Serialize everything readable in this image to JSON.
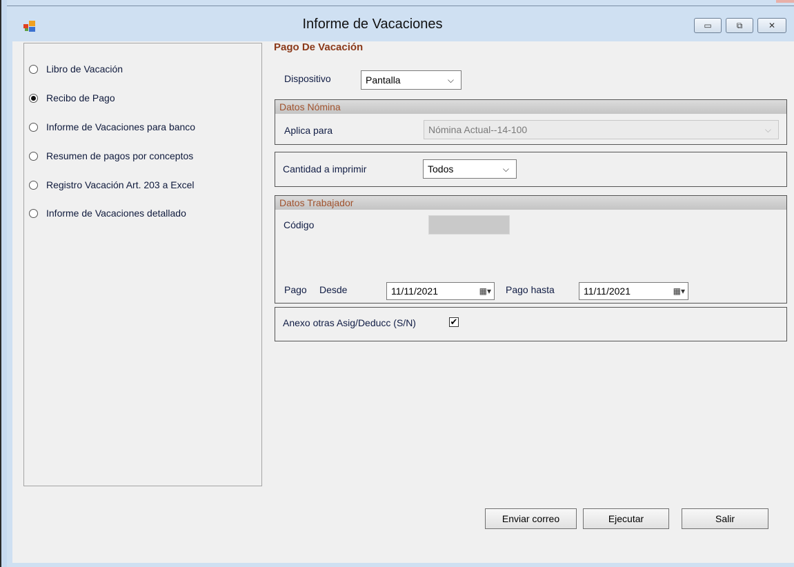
{
  "window": {
    "title": "Informe de Vacaciones",
    "minimize_label": "▭",
    "maximize_label": "⧉",
    "close_label": "✕"
  },
  "report_options": [
    {
      "label": "Libro de Vacación",
      "checked": false
    },
    {
      "label": "Recibo de Pago",
      "checked": true
    },
    {
      "label": "Informe de Vacaciones para banco",
      "checked": false
    },
    {
      "label": "Resumen de pagos por conceptos",
      "checked": false
    },
    {
      "label": "Registro Vacación Art. 203 a Excel",
      "checked": false
    },
    {
      "label": "Informe de Vacaciones detallado",
      "checked": false
    }
  ],
  "section": {
    "title": "Pago De Vacación"
  },
  "dispositivo": {
    "label": "Dispositivo",
    "value": "Pantalla"
  },
  "datos_nomina": {
    "header": "Datos Nómina",
    "aplica_label": "Aplica para",
    "aplica_value": "Nómina Actual--14-100"
  },
  "cantidad": {
    "label": "Cantidad a imprimir",
    "value": "Todos"
  },
  "datos_trabajador": {
    "header": "Datos Trabajador",
    "codigo_label": "Código",
    "pago_label": "Pago",
    "desde_label": "Desde",
    "desde_value": "11/11/2021",
    "hasta_label": "Pago hasta",
    "hasta_value": "11/11/2021"
  },
  "anexo": {
    "label": "Anexo otras Asig/Deducc (S/N)",
    "checked": true
  },
  "buttons": {
    "enviar": "Enviar correo",
    "ejecutar": "Ejecutar",
    "salir": "Salir"
  },
  "colors": {
    "section_title": "#8b3a1a",
    "group_header_text": "#a0522d",
    "label_text": "#101c44"
  }
}
